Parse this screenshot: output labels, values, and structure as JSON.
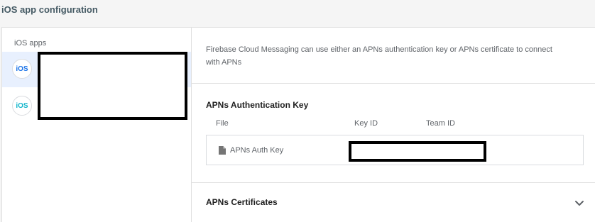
{
  "page": {
    "title": "iOS app configuration"
  },
  "sidebar": {
    "header": "iOS apps",
    "apps": [
      {
        "badge": "iOS",
        "selected": true
      },
      {
        "badge": "iOS",
        "selected": false
      }
    ]
  },
  "main": {
    "description": "Firebase Cloud Messaging can use either an APNs authentication key or APNs certificate to connect with APNs",
    "auth_key": {
      "title": "APNs Authentication Key",
      "columns": [
        "File",
        "Key ID",
        "Team ID"
      ],
      "row": {
        "file_name": "APNs Auth Key",
        "file_icon": "file-icon"
      }
    },
    "certificates": {
      "title": "APNs Certificates",
      "toggle_icon": "chevron-down-icon"
    }
  },
  "colors": {
    "accent": "#1a73e8",
    "accent_alt": "#12b5cb",
    "selected_bg": "#e8f0fe",
    "border": "#e0e0e0"
  }
}
